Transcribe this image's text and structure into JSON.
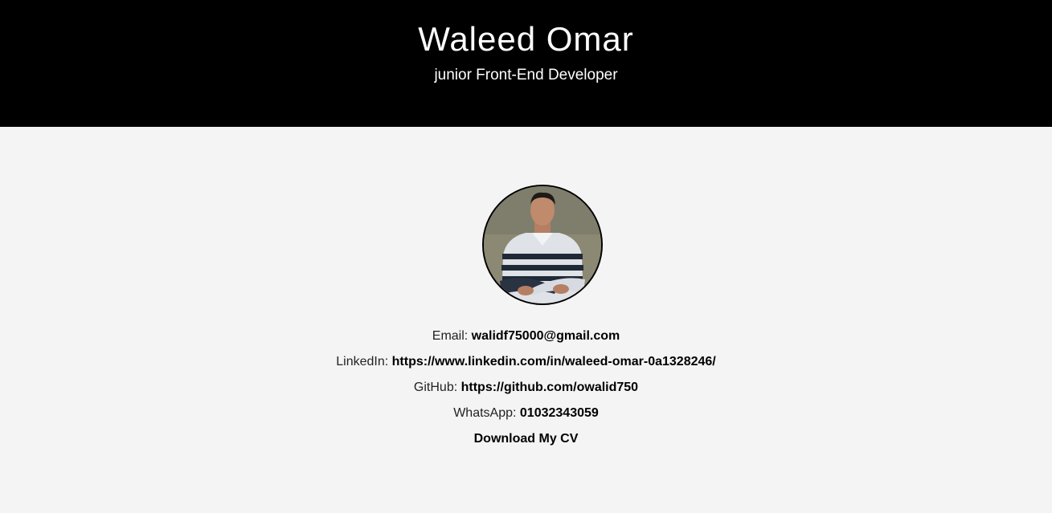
{
  "header": {
    "name": "Waleed Omar",
    "title": "junior Front-End Developer"
  },
  "colors": {
    "header_bg": "#000000",
    "page_bg": "#f4f4f4",
    "text": "#000000"
  },
  "contacts": [
    {
      "label": "Email:",
      "value": "walidf75000@gmail.com"
    },
    {
      "label": "LinkedIn:",
      "value": "https://www.linkedin.com/in/waleed-omar-0a1328246/"
    },
    {
      "label": "GitHub:",
      "value": "https://github.com/owalid750"
    },
    {
      "label": "WhatsApp:",
      "value": "01032343059"
    }
  ],
  "cv": {
    "label": "Download My CV"
  }
}
